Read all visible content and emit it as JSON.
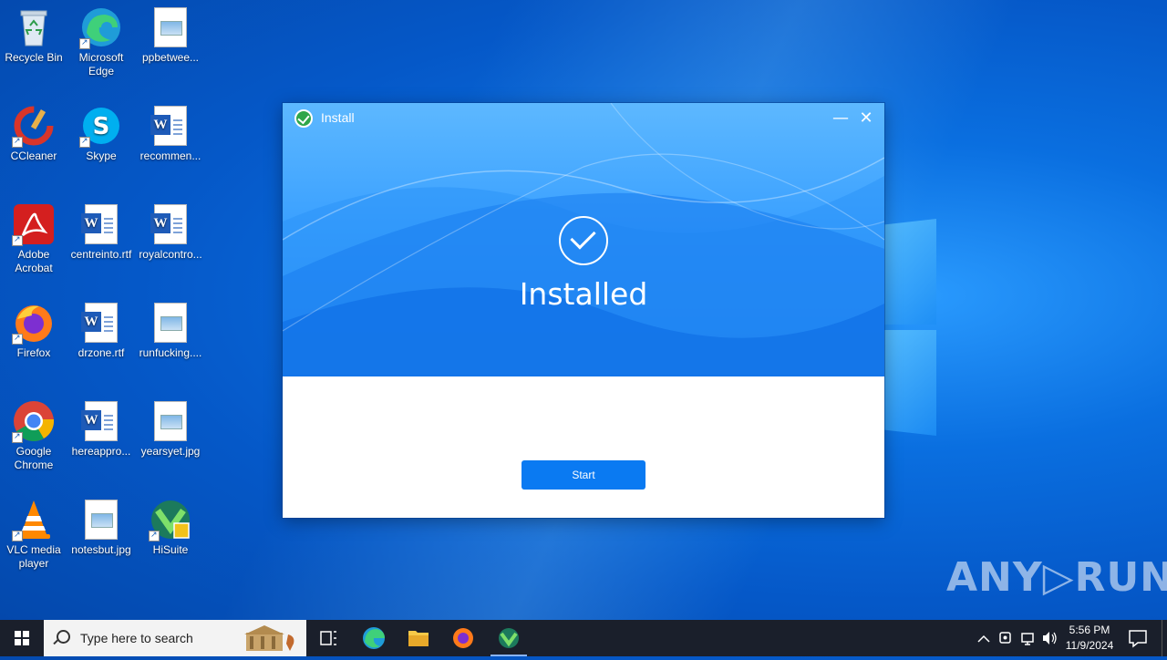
{
  "desktop": {
    "icons": [
      {
        "label": "Recycle Bin"
      },
      {
        "label": "Microsoft Edge"
      },
      {
        "label": "ppbetwee..."
      },
      {
        "label": "CCleaner"
      },
      {
        "label": "Skype"
      },
      {
        "label": "recommen..."
      },
      {
        "label": "Adobe Acrobat"
      },
      {
        "label": "centreinto.rtf"
      },
      {
        "label": "royalcontro..."
      },
      {
        "label": "Firefox"
      },
      {
        "label": "drzone.rtf"
      },
      {
        "label": "runfucking...."
      },
      {
        "label": "Google Chrome"
      },
      {
        "label": "hereappro..."
      },
      {
        "label": "yearsyet.jpg"
      },
      {
        "label": "VLC media player"
      },
      {
        "label": "notesbut.jpg"
      },
      {
        "label": "HiSuite"
      }
    ]
  },
  "installer": {
    "title": "Install",
    "minimize_glyph": "—",
    "close_glyph": "✕",
    "status": "Installed",
    "start_label": "Start"
  },
  "taskbar": {
    "search_placeholder": "Type here to search",
    "time": "5:56 PM",
    "date": "11/9/2024"
  },
  "watermark": "ANY▷RUN",
  "colors": {
    "accent": "#0a7af2",
    "taskbar": "#1a1f2b",
    "hero_top": "#5db8ff",
    "hero_bottom": "#1f86f0"
  }
}
